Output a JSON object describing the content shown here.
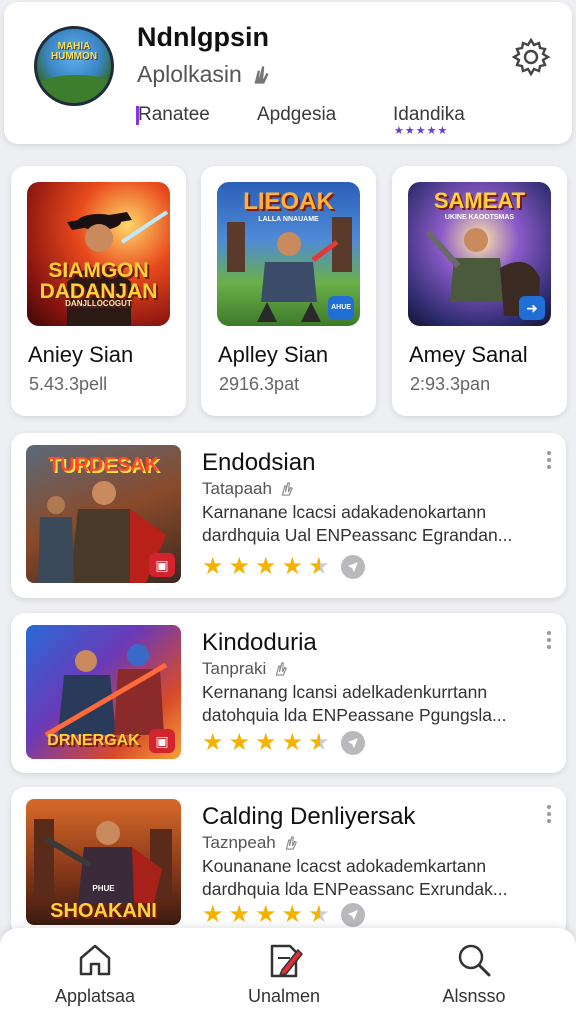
{
  "header": {
    "logo_text": "MAHIA HUMMON",
    "title": "Ndnlgpsin",
    "subtitle": "Aplolkasin",
    "links": [
      "Ranatee",
      "Apdgesia",
      "Idandika"
    ],
    "rating_stars": "★★★★★"
  },
  "featured": [
    {
      "name": "Aniey Sian",
      "meta": "5.43.3pell",
      "art_title": "SIAMGON DADANJAN",
      "art_sub": "DANJLLOCOGUT"
    },
    {
      "name": "Aplley Sian",
      "meta": "2916.3pat",
      "art_title": "LIEOAK",
      "art_sub": "LALLA NNAUAME",
      "badge": "AHUE"
    },
    {
      "name": "Amey Sanal",
      "meta": "2:93.3pan",
      "art_title": "SAMEAT",
      "art_sub": "UKINE KAOOTSMAS",
      "badge": "➜"
    }
  ],
  "list": [
    {
      "name": "Endodsian",
      "category": "Tatapaah",
      "description": "Karnanane lcacsi adakadenokartann dardhquia Ual ENPeassanc Egrandan...",
      "art_title": "TURDESAK",
      "rating": 4.5
    },
    {
      "name": "Kindoduria",
      "category": "Tanpraki",
      "description": "Kernanang lcansi adelkadenkurrtann datohquia lda ENPeassane Pgungsla...",
      "art_title": "DRNERGAK",
      "rating": 4.5
    },
    {
      "name": "Calding Denliyersak",
      "category": "Taznpeah",
      "description": "Kounanane lcacst adokademkartann dardhquia lda ENPeassanc Exrundak...",
      "art_title": "SHOAKANI",
      "art_sub": "PHUE",
      "rating": 4.5
    }
  ],
  "bottom_nav": [
    {
      "label": "Applatsaa",
      "icon": "home-icon"
    },
    {
      "label": "Unalmen",
      "icon": "edit-document-icon"
    },
    {
      "label": "Alsnsso",
      "icon": "search-icon"
    }
  ],
  "colors": {
    "accent": "#6a38d6",
    "star": "#f5b301",
    "badge_blue": "#1f6fd6",
    "badge_red": "#d3232c"
  }
}
